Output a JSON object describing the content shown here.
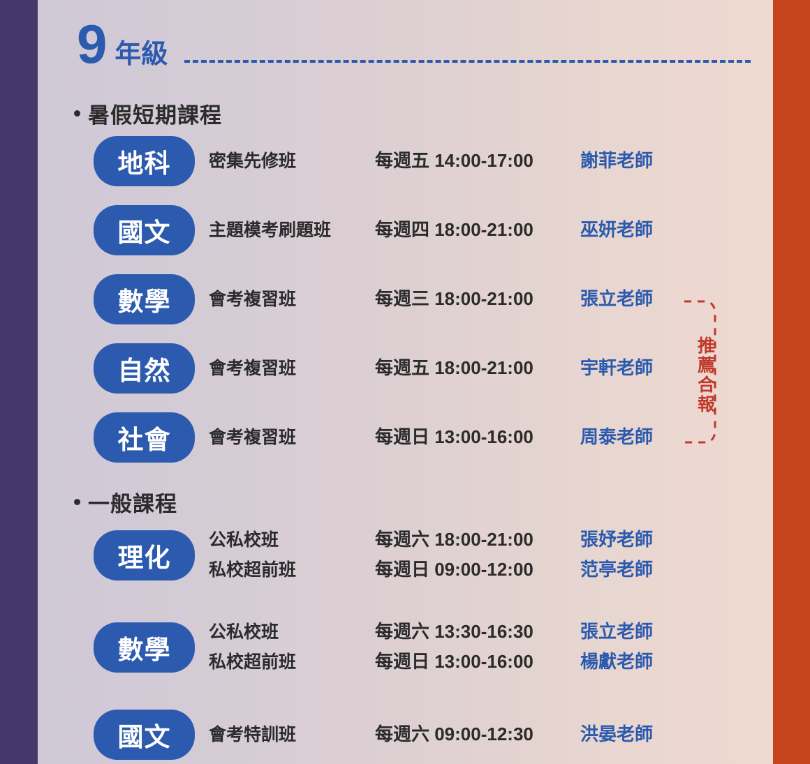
{
  "theme": {
    "brand_blue": "#2b5aae",
    "left_bar_color": "#47366b",
    "right_bar_color": "#c6441c",
    "accent_red": "#c0392b",
    "text_dark": "#2b2b2b"
  },
  "header": {
    "grade_number": "9",
    "grade_label": "年級"
  },
  "sections": [
    {
      "title": "暑假短期課程",
      "rows": [
        {
          "subject": "地科",
          "lines": [
            {
              "course": "密集先修班",
              "time": "每週五 14:00-17:00",
              "teacher": "謝菲老師"
            }
          ]
        },
        {
          "subject": "國文",
          "lines": [
            {
              "course": "主題模考刷題班",
              "time": "每週四 18:00-21:00",
              "teacher": "巫妍老師"
            }
          ]
        },
        {
          "subject": "數學",
          "lines": [
            {
              "course": "會考複習班",
              "time": "每週三 18:00-21:00",
              "teacher": "張立老師"
            }
          ]
        },
        {
          "subject": "自然",
          "lines": [
            {
              "course": "會考複習班",
              "time": "每週五 18:00-21:00",
              "teacher": "宇軒老師"
            }
          ]
        },
        {
          "subject": "社會",
          "lines": [
            {
              "course": "會考複習班",
              "time": "每週日 13:00-16:00",
              "teacher": "周泰老師"
            }
          ]
        }
      ]
    },
    {
      "title": "一般課程",
      "rows": [
        {
          "subject": "理化",
          "lines": [
            {
              "course": "公私校班",
              "time": "每週六 18:00-21:00",
              "teacher": "張妤老師"
            },
            {
              "course": "私校超前班",
              "time": "每週日 09:00-12:00",
              "teacher": "范亭老師"
            }
          ]
        },
        {
          "subject": "數學",
          "lines": [
            {
              "course": "公私校班",
              "time": "每週六 13:30-16:30",
              "teacher": "張立老師"
            },
            {
              "course": "私校超前班",
              "time": "每週日 13:00-16:00",
              "teacher": "楊獻老師"
            }
          ]
        },
        {
          "subject": "國文",
          "lines": [
            {
              "course": "會考特訓班",
              "time": "每週六 09:00-12:30",
              "teacher": "洪晏老師"
            }
          ]
        }
      ]
    }
  ],
  "recommendation": {
    "label": "推薦合報"
  }
}
